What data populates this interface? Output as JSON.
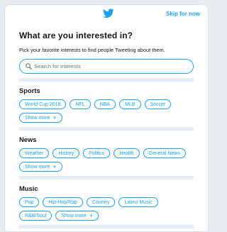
{
  "header": {
    "logo": "twitter-bird-icon",
    "skip_label": "Skip for now"
  },
  "title": "What are you interested in?",
  "subtitle": "Pick your favorite interests to find people Tweeting about them.",
  "search": {
    "placeholder": "Search for interests",
    "value": ""
  },
  "sections": [
    {
      "title": "Sports",
      "chips": [
        "World Cup 2018",
        "NFL",
        "NBA",
        "MLB",
        "Soccer"
      ],
      "more": "Show more"
    },
    {
      "title": "News",
      "chips": [
        "Weather",
        "History",
        "Politics",
        "Health",
        "General News"
      ],
      "more": "Show more"
    },
    {
      "title": "Music",
      "chips": [
        "Pop",
        "Hip-Hop/Rap",
        "Country",
        "Latino Music",
        "R&B/Soul"
      ],
      "more": "Show more"
    }
  ],
  "colors": {
    "accent": "#1da1f2",
    "text": "#14171a",
    "divider": "#e6ecf0"
  }
}
